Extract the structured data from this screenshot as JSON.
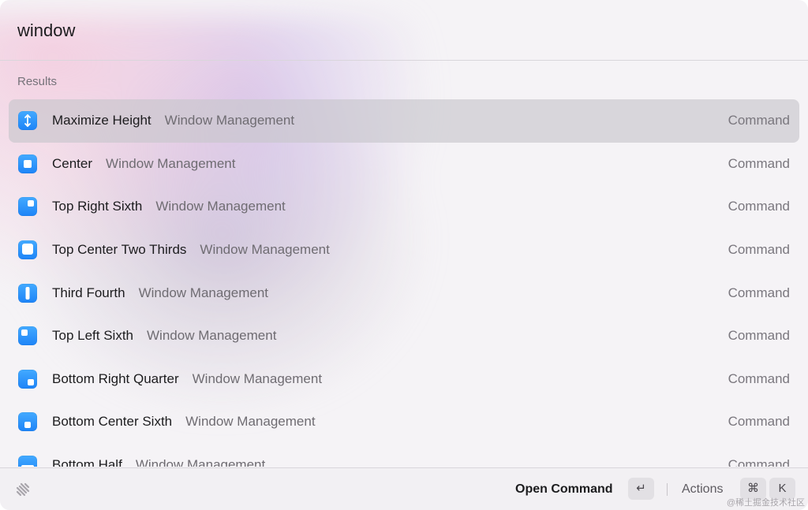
{
  "search": {
    "query": "window"
  },
  "section_title": "Results",
  "results": [
    {
      "title": "Maximize Height",
      "subtitle": "Window Management",
      "type": "Command",
      "icon": "maximize-height-icon",
      "selected": true
    },
    {
      "title": "Center",
      "subtitle": "Window Management",
      "type": "Command",
      "icon": "center-icon",
      "selected": false
    },
    {
      "title": "Top Right Sixth",
      "subtitle": "Window Management",
      "type": "Command",
      "icon": "top-right-sixth-icon",
      "selected": false
    },
    {
      "title": "Top Center Two Thirds",
      "subtitle": "Window Management",
      "type": "Command",
      "icon": "top-center-two-thirds-icon",
      "selected": false
    },
    {
      "title": "Third Fourth",
      "subtitle": "Window Management",
      "type": "Command",
      "icon": "third-fourth-icon",
      "selected": false
    },
    {
      "title": "Top Left Sixth",
      "subtitle": "Window Management",
      "type": "Command",
      "icon": "top-left-sixth-icon",
      "selected": false
    },
    {
      "title": "Bottom Right Quarter",
      "subtitle": "Window Management",
      "type": "Command",
      "icon": "bottom-right-quarter-icon",
      "selected": false
    },
    {
      "title": "Bottom Center Sixth",
      "subtitle": "Window Management",
      "type": "Command",
      "icon": "bottom-center-sixth-icon",
      "selected": false
    },
    {
      "title": "Bottom Half",
      "subtitle": "Window Management",
      "type": "Command",
      "icon": "bottom-half-icon",
      "selected": false
    }
  ],
  "footer": {
    "logo_icon": "raycast-logo-icon",
    "primary_action": "Open Command",
    "primary_key": "↵",
    "actions_label": "Actions",
    "actions_keys": [
      "⌘",
      "K"
    ],
    "watermark": "@稀土掘金技术社区"
  },
  "colors": {
    "accent": "#1e84f7",
    "selected_row": "#cfcdd2"
  }
}
